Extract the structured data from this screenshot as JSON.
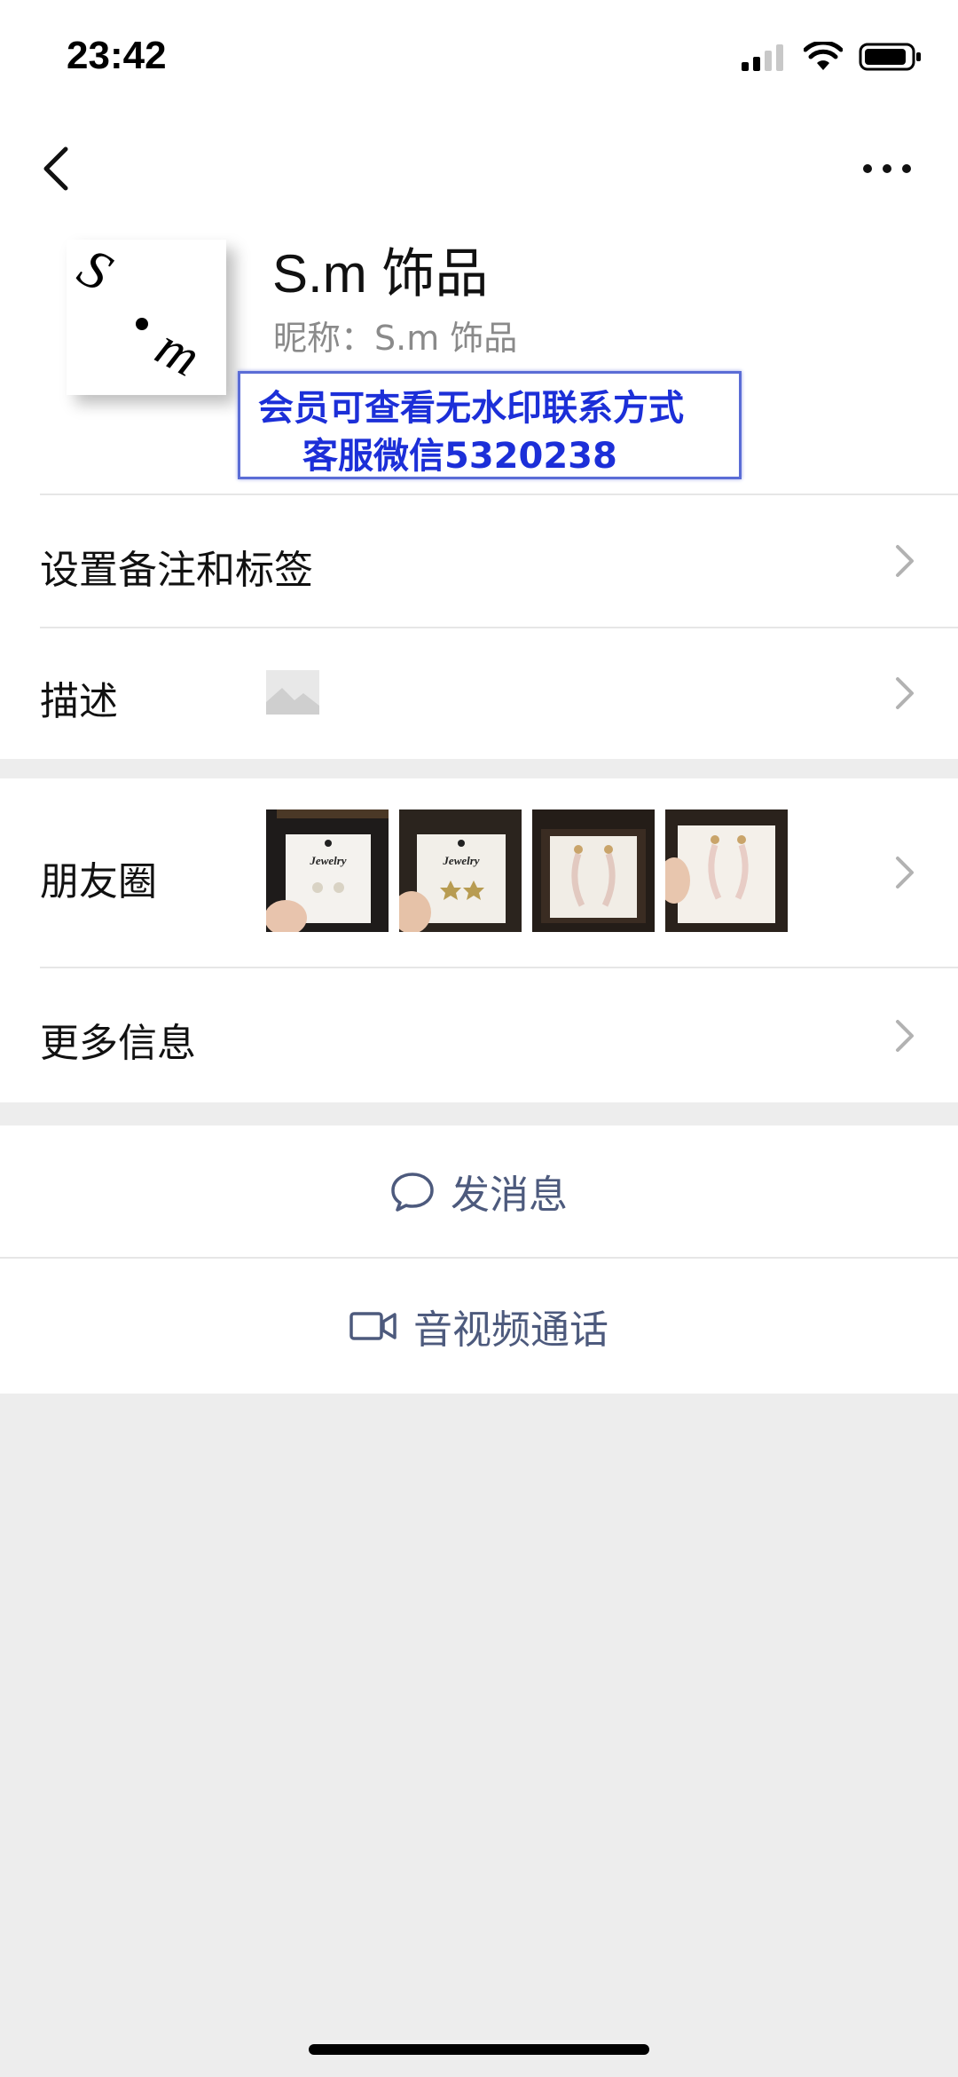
{
  "status_bar": {
    "time": "23:42"
  },
  "profile": {
    "name": "S.m 饰品",
    "nickname": "昵称：S.m 饰品",
    "avatar_text": "S.m"
  },
  "watermark": {
    "line1": "会员可查看无水印联系方式",
    "line2": "客服微信5320238"
  },
  "rows": {
    "remark": "设置备注和标签",
    "description": "描述",
    "moments": "朋友圈",
    "more_info": "更多信息"
  },
  "moments_thumbs": [
    {
      "label": "Jewelry"
    },
    {
      "label": "Jewelry"
    },
    {
      "label": ""
    },
    {
      "label": ""
    }
  ],
  "actions": {
    "send_message": "发消息",
    "video_call": "音视频通话"
  },
  "colors": {
    "accent_text": "#4d5a7d",
    "watermark_text": "#1c2fd8",
    "background": "#ededed"
  }
}
